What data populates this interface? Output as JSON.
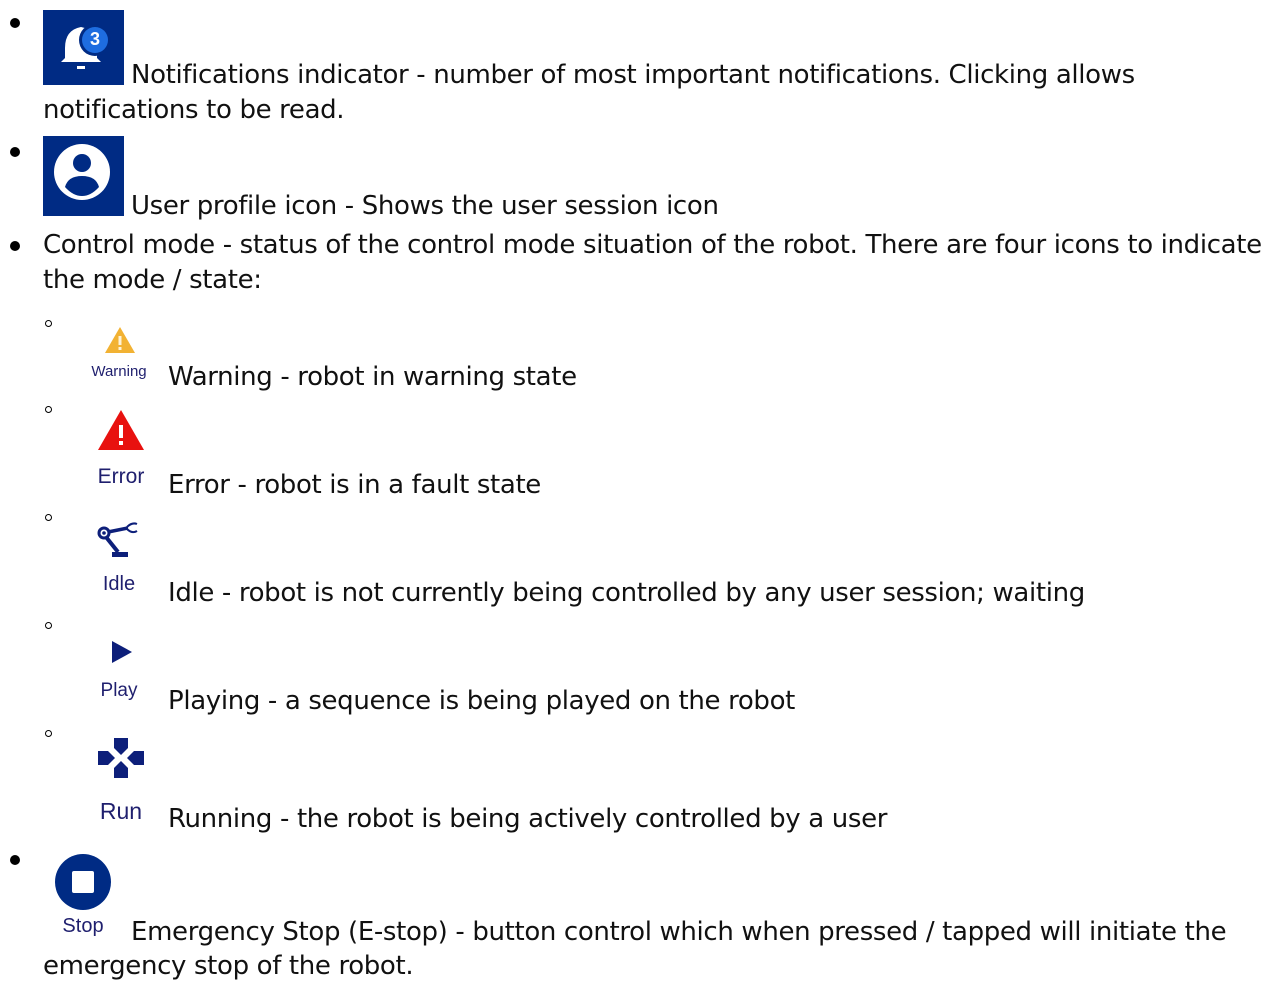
{
  "items": [
    {
      "icon": "bell-icon",
      "badge": "3",
      "line1": "Notifications indicator - number of most important notifications. Clicking allows",
      "line2": "notifications to be read."
    },
    {
      "icon": "user-profile-icon",
      "line1": "User profile icon - Shows the user session icon"
    },
    {
      "line1": "Control mode - status of the control mode situation of the robot. There are four icons to indicate",
      "line2": "the mode / state:",
      "modes": [
        {
          "icon": "warning-icon",
          "caption": "Warning",
          "text": "Warning - robot in warning state",
          "color": "#f2b233"
        },
        {
          "icon": "error-icon",
          "caption": "Error",
          "text": "Error - robot is in a fault state",
          "color": "#e8110f"
        },
        {
          "icon": "robot-arm-icon",
          "caption": "Idle",
          "text": "Idle - robot is not currently being controlled by any user session; waiting",
          "color": "#0d1f7a"
        },
        {
          "icon": "play-icon",
          "caption": "Play",
          "text": "Playing - a sequence is being played on the robot",
          "color": "#0d1f7a"
        },
        {
          "icon": "gamepad-icon",
          "caption": "Run",
          "text": "Running - the robot is being actively controlled by a user",
          "color": "#0d1f7a"
        }
      ]
    },
    {
      "icon": "stop-icon",
      "caption": "Stop",
      "line1": "Emergency Stop (E-stop) - button control which when pressed / tapped will initiate the",
      "line2": "emergency stop of the robot."
    }
  ],
  "colors": {
    "icon_background": "#002b84",
    "badge": "#1e6de0",
    "navy": "#0d1f7a"
  }
}
